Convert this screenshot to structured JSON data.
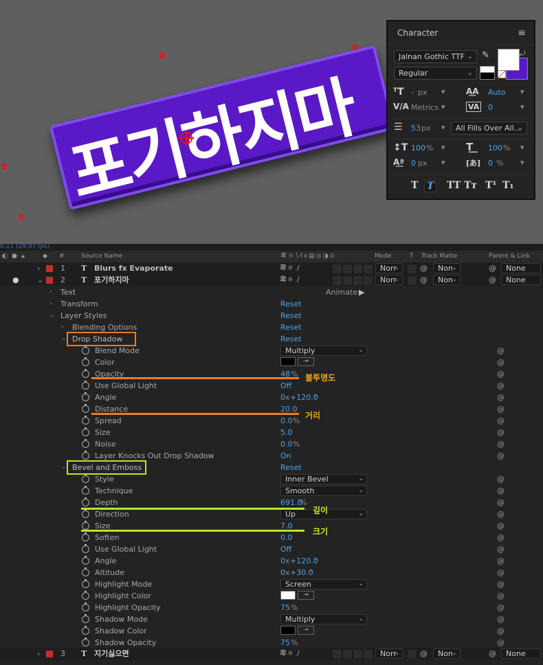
{
  "viewer": {
    "title_text": "포기하지마"
  },
  "character": {
    "panel_title": "Character",
    "font_family": "Jalnan Gothic TTF",
    "font_style": "Regular",
    "size_value": "-",
    "size_unit": "px",
    "leading_value": "Auto",
    "kerning_value": "Metrics",
    "tracking_value": "0",
    "stroke_value": "53",
    "stroke_unit": "px",
    "stroke_mode": "All Fills Over All...",
    "vscale_value": "100",
    "vscale_unit": "%",
    "hscale_value": "100",
    "hscale_unit": "%",
    "baseline_value": "0",
    "baseline_unit": "px",
    "tsume_value": "0",
    "tsume_unit": "%",
    "fill_color": "#ffffff",
    "stroke_color": "#5a19c6",
    "style_buttons": [
      "T",
      "T",
      "TT",
      "Tт",
      "T¹",
      "T₁"
    ]
  },
  "timeline": {
    "top_strip": "0:11 (29.97 fps)",
    "headers": {
      "num": "#",
      "source_name": "Source Name",
      "mode": "Mode",
      "t": "T",
      "track_matte": "Track Matte",
      "parent_link": "Parent & Link"
    },
    "layers": [
      {
        "num": "1",
        "type": "T",
        "name": "Blurs fx Evaporate",
        "mode": "Norr",
        "matte": "Non",
        "parent": "None"
      },
      {
        "num": "2",
        "type": "T",
        "name": "포기하지마",
        "mode": "Norr",
        "matte": "Non",
        "parent": "None"
      },
      {
        "num": "3",
        "type": "T",
        "name": "지기싫으면",
        "mode": "Norr",
        "matte": "Non",
        "parent": "None"
      }
    ],
    "animate_label": "Animate:",
    "reset_label": "Reset",
    "props": {
      "text": "Text",
      "transform": "Transform",
      "layer_styles": "Layer Styles",
      "blending_options": "Blending Options",
      "drop_shadow": "Drop Shadow",
      "bevel_emboss": "Bevel and Emboss"
    },
    "drop_shadow": {
      "blend_mode_label": "Blend Mode",
      "blend_mode": "Multiply",
      "color_label": "Color",
      "color": "#000000",
      "opacity_label": "Opacity",
      "opacity": "48",
      "opacity_unit": "%",
      "global_light_label": "Use Global Light",
      "global_light": "Off",
      "angle_label": "Angle",
      "angle_prefix": "0",
      "angle_x": "x",
      "angle_value": "+120.0",
      "angle_unit": "°",
      "distance_label": "Distance",
      "distance": "20.0",
      "spread_label": "Spread",
      "spread": "0.0",
      "spread_unit": "%",
      "size_label": "Size",
      "size": "5.0",
      "noise_label": "Noise",
      "noise": "0.0",
      "noise_unit": "%",
      "knocks_label": "Layer Knocks Out Drop Shadow",
      "knocks": "On"
    },
    "bevel": {
      "style_label": "Style",
      "style": "Inner Bevel",
      "technique_label": "Technique",
      "technique": "Smooth",
      "depth_label": "Depth",
      "depth": "691.0",
      "depth_unit": "%",
      "direction_label": "Direction",
      "direction": "Up",
      "size_label": "Size",
      "size": "7.0",
      "soften_label": "Soften",
      "soften": "0.0",
      "global_light_label": "Use Global Light",
      "global_light": "Off",
      "angle_label": "Angle",
      "angle_prefix": "0",
      "angle_x": "x",
      "angle_value": "+120.0",
      "angle_unit": "°",
      "altitude_label": "Altitude",
      "altitude_prefix": "0",
      "altitude_x": "x",
      "altitude_value": "+30.0",
      "altitude_unit": "°",
      "hl_mode_label": "Highlight Mode",
      "hl_mode": "Screen",
      "hl_color_label": "Highlight Color",
      "hl_color": "#ffffff",
      "hl_opacity_label": "Highlight Opacity",
      "hl_opacity": "75",
      "hl_opacity_unit": "%",
      "sh_mode_label": "Shadow Mode",
      "sh_mode": "Multiply",
      "sh_color_label": "Shadow Color",
      "sh_color": "#000000",
      "sh_opacity_label": "Shadow Opacity",
      "sh_opacity": "75",
      "sh_opacity_unit": "%"
    },
    "annotations": {
      "opacity_note": "불투명도",
      "distance_note": "거리",
      "depth_note": "깊이",
      "size_note": "크기",
      "orange": "#f07c1e",
      "green": "#b9e62a"
    }
  }
}
